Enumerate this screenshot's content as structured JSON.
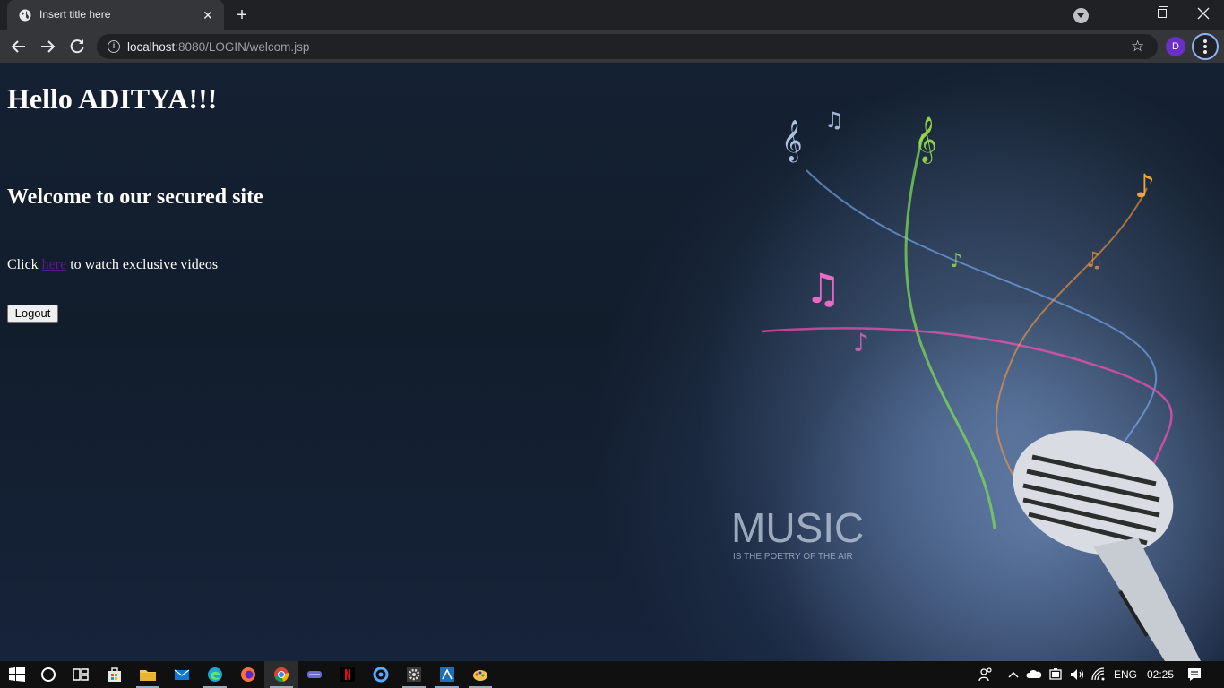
{
  "browser": {
    "tab": {
      "title": "Insert title here"
    },
    "url": {
      "host": "localhost",
      "rest": ":8080/LOGIN/welcom.jsp"
    },
    "profile_initial": "D"
  },
  "page": {
    "greeting": "Hello ADITYA!!!",
    "welcome": "Welcome to our secured site",
    "click_prefix": "Click ",
    "link_text": "here",
    "click_suffix": " to watch exclusive videos",
    "logout_label": "Logout",
    "art": {
      "music_text": "MUSIC",
      "music_subtext": "IS THE POETRY OF THE AIR"
    }
  },
  "taskbar": {
    "apps": [
      "windows-start-icon",
      "cortana-icon",
      "task-view-icon",
      "store-icon",
      "file-explorer-icon",
      "mail-icon",
      "edge-icon",
      "firefox-icon",
      "chrome-icon",
      "app-icon",
      "netflix-icon",
      "app-icon",
      "settings-icon",
      "app-icon",
      "paint-icon"
    ],
    "language": "ENG",
    "time": "02:25"
  },
  "colors": {
    "accent": "#8ab4f8",
    "profile": "#6a2fc9",
    "link_visited": "#551a8b"
  }
}
